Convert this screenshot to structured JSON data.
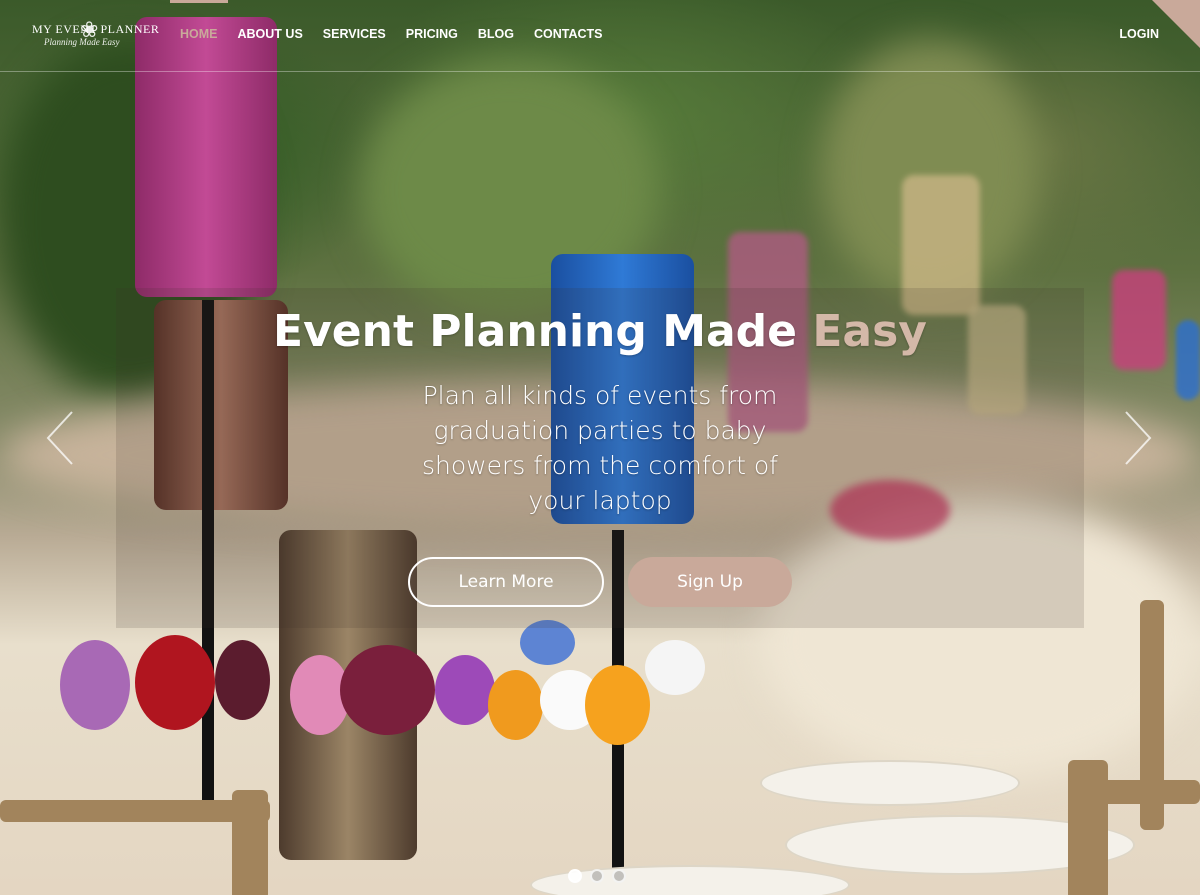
{
  "brand": {
    "name": "MY EVENT PLANNER",
    "tagline": "Planning Made Easy"
  },
  "nav": {
    "items": [
      {
        "label": "HOME",
        "active": true
      },
      {
        "label": "ABOUT US"
      },
      {
        "label": "SERVICES"
      },
      {
        "label": "PRICING"
      },
      {
        "label": "BLOG"
      },
      {
        "label": "CONTACTS"
      }
    ],
    "login": "LOGIN"
  },
  "hero": {
    "title_main": "Event Planning Made ",
    "title_accent": "Easy",
    "subtitle": "Plan all kinds of events from graduation parties to baby showers from the comfort of your laptop",
    "learn_more": "Learn More",
    "sign_up": "Sign Up"
  },
  "slider": {
    "slide_count": 3,
    "active_index": 0
  },
  "colors": {
    "accent": "#c9a99a",
    "text": "#ffffff"
  }
}
